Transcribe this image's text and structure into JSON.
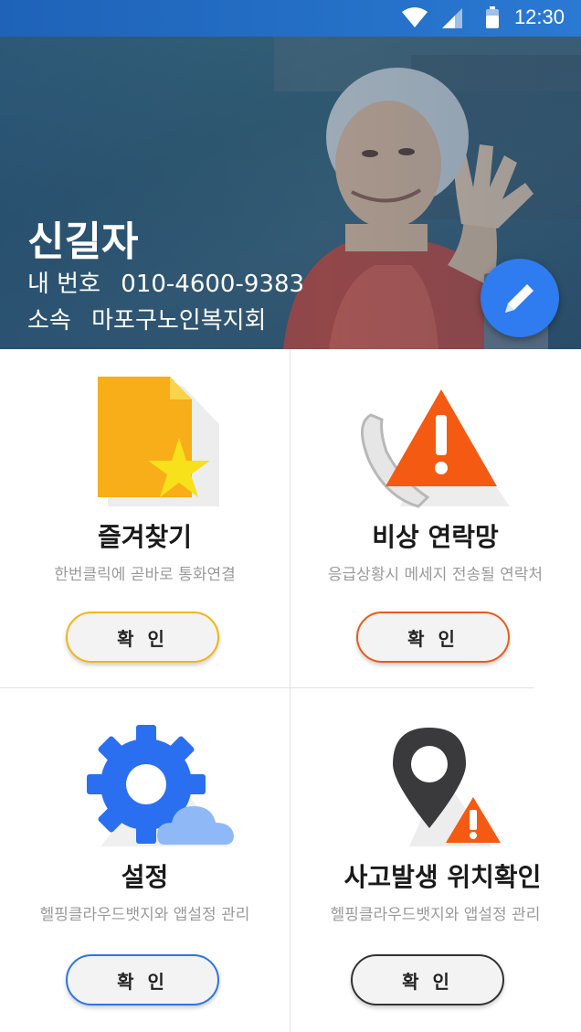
{
  "status_bar": {
    "time": "12:30"
  },
  "profile": {
    "name": "신길자",
    "phone_label": "내 번호",
    "phone_value": "010-4600-9383",
    "org_label": "소속",
    "org_value": "마포구노인복지회"
  },
  "cards": [
    {
      "title": "즐겨찾기",
      "desc": "한번클릭에 곧바로 통화연결",
      "button": "확 인",
      "accent": "#f5b517"
    },
    {
      "title": "비상 연락망",
      "desc": "응급상황시 메세지 전송될 연락처",
      "button": "확 인",
      "accent": "#ec5a1a"
    },
    {
      "title": "설정",
      "desc": "헬핑클라우드뱃지와 앱설정 관리",
      "button": "확 인",
      "accent": "#2f74e8"
    },
    {
      "title": "사고발생 위치확인",
      "desc": "헬핑클라우드뱃지와 앱설정 관리",
      "button": "확 인",
      "accent": "#333333"
    }
  ],
  "icons": {
    "status": [
      "wifi-icon",
      "signal-icon",
      "battery-icon"
    ],
    "edit": "pencil-icon",
    "cards": [
      "favorite-document-icon",
      "emergency-call-warning-icon",
      "settings-gear-cloud-icon",
      "location-pin-warning-icon"
    ]
  }
}
